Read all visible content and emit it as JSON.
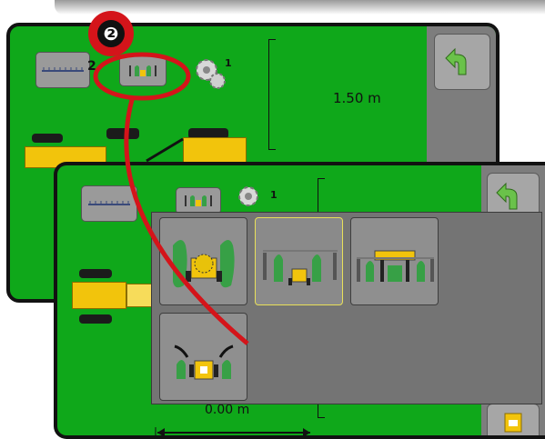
{
  "step_badge": "❷",
  "back_screen": {
    "boom_count": "2",
    "section_count": "1",
    "width_value": "1.50 m",
    "undo_icon": "undo-arrow-icon",
    "colors": {
      "background": "#0fa81a",
      "sidebar": "#7d7d7d",
      "vehicle": "#f2c40c"
    }
  },
  "front_screen": {
    "section_count": "1",
    "width_value_partial": "0.00 m",
    "undo_icon": "undo-arrow-icon"
  },
  "popup": {
    "options": [
      {
        "icon": "front-spreader-mode-icon",
        "selected": false
      },
      {
        "icon": "rear-boom-mode-icon",
        "selected": true
      },
      {
        "icon": "wide-boom-mode-icon",
        "selected": false
      },
      {
        "icon": "trailed-sprayer-mode-icon",
        "selected": false
      }
    ]
  },
  "colors": {
    "callout": "#d4141a",
    "highlight": "#e8e05a"
  }
}
